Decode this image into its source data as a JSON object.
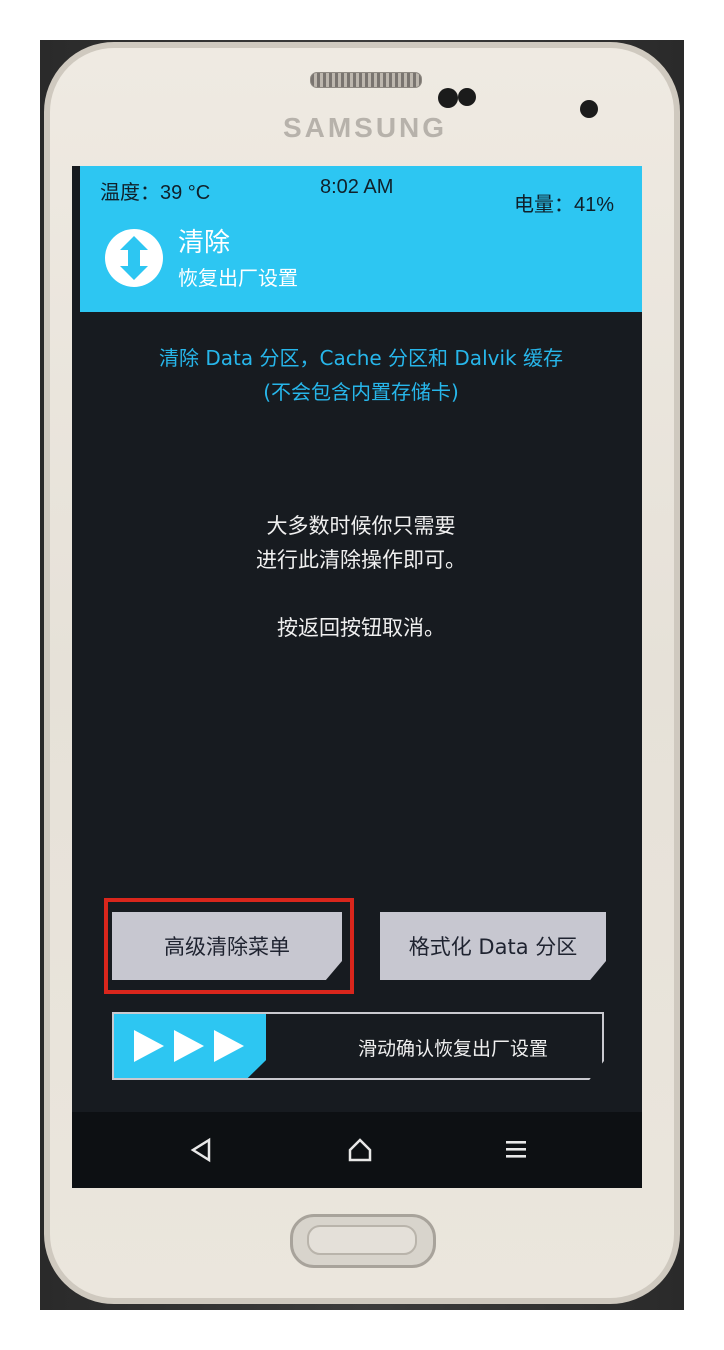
{
  "device": {
    "brand": "SAMSUNG"
  },
  "status_bar": {
    "temperature": "温度：39 °C",
    "time": "8:02 AM",
    "battery": "电量：41%"
  },
  "header": {
    "title": "清除",
    "subtitle": "恢复出厂设置",
    "icon": "twrp-logo-icon"
  },
  "info": {
    "line1": "清除 Data 分区，Cache 分区和 Dalvik 缓存",
    "line2": "(不会包含内置存储卡)"
  },
  "message": {
    "line1": "大多数时候你只需要",
    "line2": "进行此清除操作即可。",
    "line3": "按返回按钮取消。"
  },
  "buttons": {
    "advanced_wipe": "高级清除菜单",
    "format_data": "格式化 Data 分区"
  },
  "slider": {
    "label": "滑动确认恢复出厂设置",
    "icon": "triple-arrow-icon"
  },
  "navbar": {
    "back_icon": "back-triangle-icon",
    "home_icon": "home-icon",
    "menu_icon": "menu-lines-icon"
  },
  "colors": {
    "accent": "#2dc6f2",
    "screen_bg": "#171b20",
    "highlight": "#d9261c",
    "button_bg": "#c7c7d0"
  }
}
